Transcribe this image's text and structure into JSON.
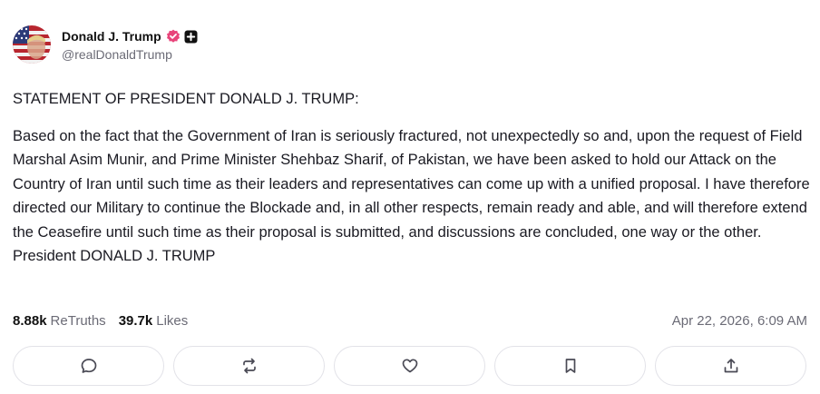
{
  "post": {
    "author": {
      "display_name": "Donald J. Trump",
      "handle": "@realDonaldTrump",
      "verified": true,
      "avatar_icon": "avatar-image",
      "verified_color": "#e8447a"
    },
    "title": "STATEMENT OF PRESIDENT DONALD J. TRUMP:",
    "body": "Based on the fact that the Government of Iran is seriously fractured, not unexpectedly so and, upon the request of Field Marshal Asim Munir, and Prime Minister Shehbaz Sharif, of Pakistan, we have been asked to hold our Attack on the Country of Iran until such time as their leaders and representatives can come up with a unified proposal. I have therefore directed our Military to continue the Blockade and, in all other respects, remain ready and able, and will therefore extend the Ceasefire until such time as their proposal is submitted, and discussions are concluded, one way or the other. President DONALD J. TRUMP",
    "stats": {
      "retruths_count": "8.88k",
      "retruths_label": "ReTruths",
      "likes_count": "39.7k",
      "likes_label": "Likes"
    },
    "timestamp": "Apr 22, 2026, 6:09 AM",
    "actions": [
      {
        "icon": "reply-icon"
      },
      {
        "icon": "retruth-icon"
      },
      {
        "icon": "like-icon"
      },
      {
        "icon": "bookmark-icon"
      },
      {
        "icon": "share-icon"
      }
    ]
  }
}
